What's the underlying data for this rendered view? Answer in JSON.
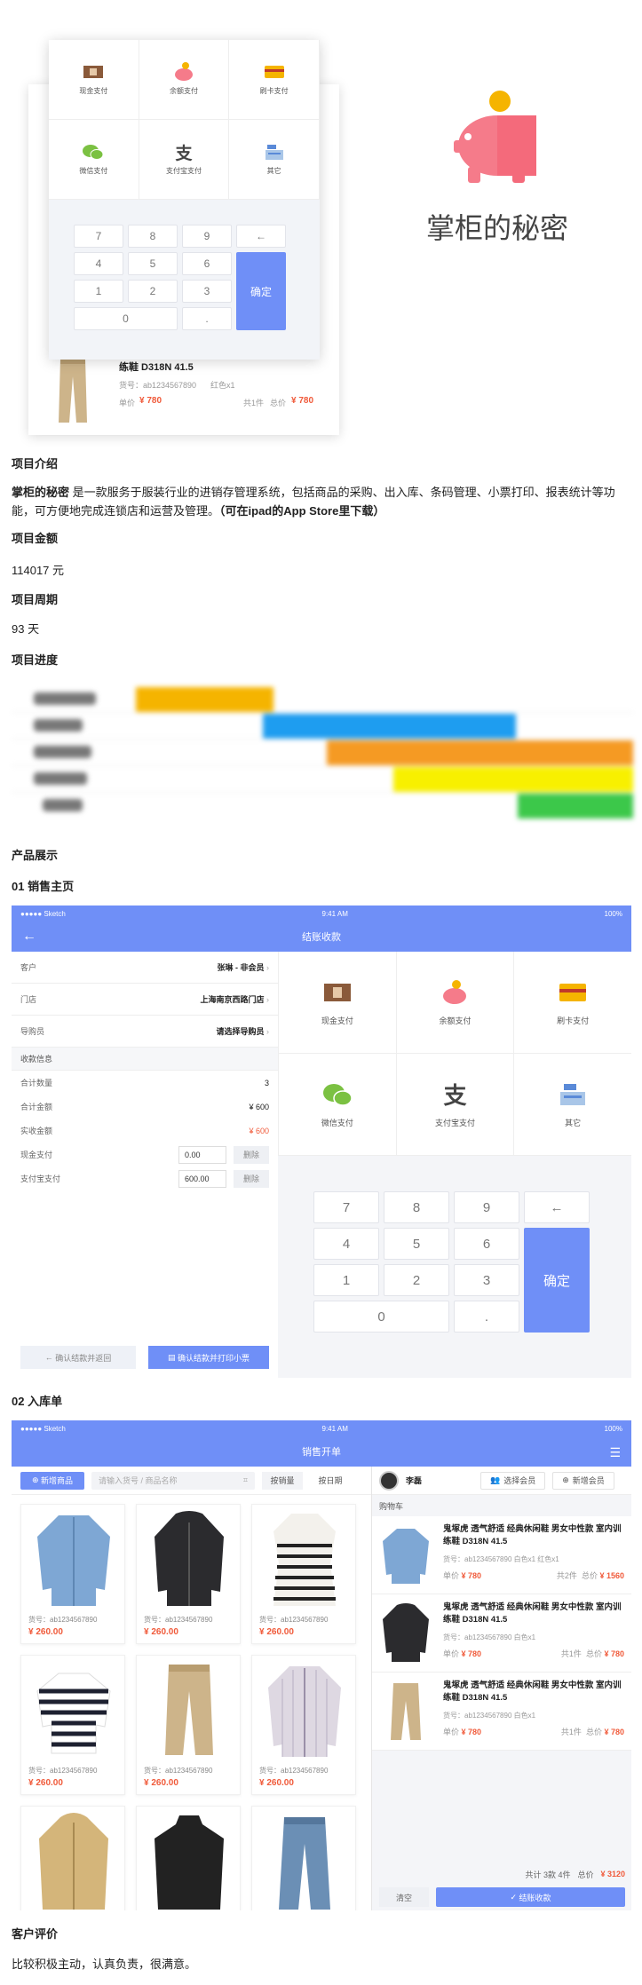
{
  "hero": {
    "pay_methods": [
      "现金支付",
      "余额支付",
      "刷卡支付",
      "微信支付",
      "支付宝支付",
      "其它"
    ],
    "keys": [
      "7",
      "8",
      "9",
      "←",
      "4",
      "5",
      "6",
      "1",
      "2",
      "3",
      "0",
      "."
    ],
    "confirm": "确定",
    "back_item": {
      "name": "练鞋 D318N 41.5",
      "sku": "货号：ab1234567890",
      "color": "红色x1",
      "unit_label": "单价",
      "unit_price": "¥ 780",
      "qty": "共1件",
      "total_label": "总价",
      "total": "¥ 780"
    },
    "brand_title": "掌柜的秘密"
  },
  "sections": {
    "intro_h": "项目介绍",
    "intro_bold": "掌柜的秘密",
    "intro_body": " 是一款服务于服装行业的进销存管理系统，包括商品的采购、出入库、条码管理、小票打印、报表统计等功能，可方便地完成连锁店和运营及管理。",
    "intro_tail": "（可在ipad的App Store里下载）",
    "amount_h": "项目金额",
    "amount_v": "114017 元",
    "period_h": "项目周期",
    "period_v": "93 天",
    "progress_h": "项目进度",
    "products_h": "产品展示",
    "s1_h": "01 销售主页",
    "s2_h": "02 入库单",
    "review_h": "客户评价",
    "review_v": "比较积极主动，认真负责，很满意。"
  },
  "gantt_colors": [
    "#f5b400",
    "#1e9df0",
    "#f59a23",
    "#f8f000",
    "#3cc84a"
  ],
  "screen1": {
    "status_left": "●●●●● Sketch",
    "status_time": "9:41 AM",
    "status_right": "100%",
    "title": "结账收款",
    "rows": [
      {
        "k": "客户",
        "v": "张琳 - 非会员"
      },
      {
        "k": "门店",
        "v": "上海南京西路门店"
      },
      {
        "k": "导购员",
        "v": "请选择导购员"
      }
    ],
    "info_title": "收款信息",
    "qty_k": "合计数量",
    "qty_v": "3",
    "sum_k": "合计金额",
    "sum_v": "¥ 600",
    "paid_k": "实收金额",
    "paid_v": "¥ 600",
    "cash_k": "现金支付",
    "cash_v": "0.00",
    "alipay_k": "支付宝支付",
    "alipay_v": "600.00",
    "del": "删除",
    "btn_back": "确认结款并返回",
    "btn_print": "确认结款并打印小票",
    "pay_methods": [
      "现金支付",
      "余额支付",
      "刷卡支付",
      "微信支付",
      "支付宝支付",
      "其它"
    ],
    "keys": [
      "7",
      "8",
      "9",
      "←",
      "4",
      "5",
      "6",
      "1",
      "2",
      "3",
      "0",
      "."
    ],
    "confirm": "确定"
  },
  "screen2": {
    "status_left": "●●●●● Sketch",
    "status_time": "9:41 AM",
    "status_right": "100%",
    "title": "销售开单",
    "add": "新增商品",
    "search_ph": "请输入货号 / 商品名称",
    "sort1": "按销量",
    "sort2": "按日期",
    "cards": [
      {
        "sku": "货号：ab1234567890",
        "price": "¥ 260.00"
      },
      {
        "sku": "货号：ab1234567890",
        "price": "¥ 260.00"
      },
      {
        "sku": "货号：ab1234567890",
        "price": "¥ 260.00"
      },
      {
        "sku": "货号：ab1234567890",
        "price": "¥ 260.00"
      },
      {
        "sku": "货号：ab1234567890",
        "price": "¥ 260.00"
      },
      {
        "sku": "货号：ab1234567890",
        "price": "¥ 260.00"
      },
      {
        "sku": "",
        "price": ""
      },
      {
        "sku": "",
        "price": ""
      },
      {
        "sku": "",
        "price": ""
      }
    ],
    "user": "李磊",
    "choose_member": "选择会员",
    "new_member": "新增会员",
    "cart_title": "购物车",
    "items": [
      {
        "name": "鬼塚虎 透气舒适 经典休闲鞋 男女中性款 室内训练鞋 D318N 41.5",
        "meta": "货号：ab1234567890   白色x1  红色x1",
        "unit": "¥ 780",
        "qty": "共2件",
        "total": "¥ 1560"
      },
      {
        "name": "鬼塚虎 透气舒适 经典休闲鞋 男女中性款 室内训练鞋 D318N 41.5",
        "meta": "货号：ab1234567890   白色x1",
        "unit": "¥ 780",
        "qty": "共1件",
        "total": "¥ 780"
      },
      {
        "name": "鬼塚虎 透气舒适 经典休闲鞋 男女中性款 室内训练鞋 D318N 41.5",
        "meta": "货号：ab1234567890   白色x1",
        "unit": "¥ 780",
        "qty": "共1件",
        "total": "¥ 780"
      }
    ],
    "unit_label": "单价",
    "total_label": "总价",
    "sum_count": "共计 3款 4件",
    "sum_total_label": "总价",
    "sum_total": "¥ 3120",
    "clear": "清空",
    "checkout": "结账收款"
  }
}
